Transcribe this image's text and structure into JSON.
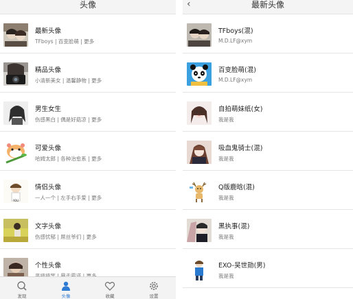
{
  "left_screen": {
    "title": "头像",
    "categories": [
      {
        "title": "最新头像",
        "subtitle": "TFboys | 百变脸萌 | 更多",
        "thumb": "couple-photo"
      },
      {
        "title": "精品头像",
        "subtitle": "小清新美女 | 温馨静物 | 更多",
        "thumb": "camera-photo"
      },
      {
        "title": "男生女生",
        "subtitle": "伤感黑白 | 偶是好菇凉 | 更多",
        "thumb": "bw-girl-photo"
      },
      {
        "title": "可爱头像",
        "subtitle": "哈姆太郎 | 各种治愈系 | 更多",
        "thumb": "hamster-cartoon"
      },
      {
        "title": "情侣头像",
        "subtitle": "一人一个 | 左手右手爱 | 更多",
        "thumb": "couple-cartoon"
      },
      {
        "title": "文字头像",
        "subtitle": "伤感忧郁 | 屌丝爷们 | 更多",
        "thumb": "field-photo"
      },
      {
        "title": "个性头像",
        "subtitle": "恶搞搞笑 | 暴走霸道 | 更多",
        "thumb": "personality-photo"
      }
    ],
    "tabbar": [
      {
        "label": "发现",
        "icon": "search-icon",
        "active": false
      },
      {
        "label": "头像",
        "icon": "avatar-icon",
        "active": true
      },
      {
        "label": "收藏",
        "icon": "heart-icon",
        "active": false
      },
      {
        "label": "设置",
        "icon": "gear-icon",
        "active": false
      }
    ]
  },
  "right_screen": {
    "title": "最新头像",
    "back_icon": "back-arrow-icon",
    "items": [
      {
        "title": "TFboys(混)",
        "subtitle": "M.D.LF@xym",
        "thumb": "tfboys-photo"
      },
      {
        "title": "百变脸萌(混)",
        "subtitle": "M.D.LF@xym",
        "thumb": "panda-cartoon"
      },
      {
        "title": "自拍萌妹纸(女)",
        "subtitle": "我是我",
        "thumb": "selfie-girl"
      },
      {
        "title": "吸血鬼骑士(混)",
        "subtitle": "我是我",
        "thumb": "anime-vampire"
      },
      {
        "title": "Q版鹿晗(混)",
        "subtitle": "我是我",
        "thumb": "deer-cartoon"
      },
      {
        "title": "黑执事(混)",
        "subtitle": "我是我",
        "thumb": "anime-butler"
      },
      {
        "title": "EXO-吴世勋(男)",
        "subtitle": "我是我",
        "thumb": "exo-cartoon"
      }
    ]
  },
  "colors": {
    "accent": "#2f7bd4",
    "header_bg": "#f4f4f4",
    "divider": "#e4e4e4"
  }
}
